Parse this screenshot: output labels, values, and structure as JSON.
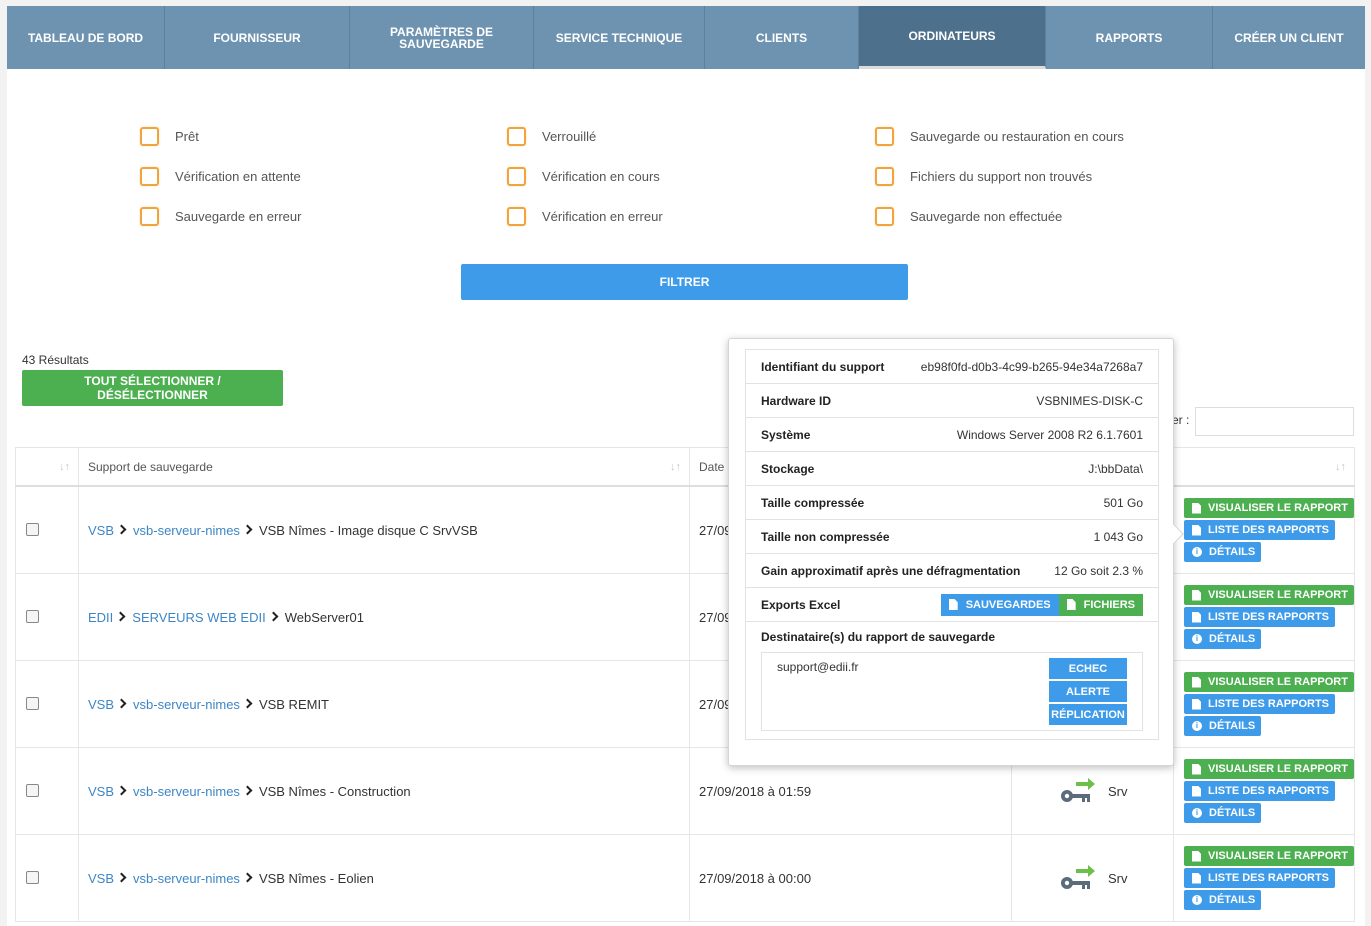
{
  "nav": {
    "tabs": [
      {
        "label": "TABLEAU DE BORD",
        "active": false
      },
      {
        "label": "FOURNISSEUR",
        "active": false
      },
      {
        "label": "PARAMÈTRES DE SAUVEGARDE",
        "active": false
      },
      {
        "label": "SERVICE TECHNIQUE",
        "active": false
      },
      {
        "label": "CLIENTS",
        "active": false
      },
      {
        "label": "ORDINATEURS",
        "active": true
      },
      {
        "label": "RAPPORTS",
        "active": false
      },
      {
        "label": "CRÉER UN CLIENT",
        "active": false
      }
    ]
  },
  "filters": {
    "items": [
      {
        "label": "Prêt",
        "checked": false
      },
      {
        "label": "Verrouillé",
        "checked": false
      },
      {
        "label": "Sauvegarde ou restauration en cours",
        "checked": false
      },
      {
        "label": "Vérification en attente",
        "checked": false
      },
      {
        "label": "Vérification en cours",
        "checked": false
      },
      {
        "label": "Fichiers du support non trouvés",
        "checked": false
      },
      {
        "label": "Sauvegarde en erreur",
        "checked": false
      },
      {
        "label": "Vérification en erreur",
        "checked": false
      },
      {
        "label": "Sauvegarde non effectuée",
        "checked": false
      }
    ],
    "button_label": "FILTRER"
  },
  "results": {
    "count_text": "43 Résultats",
    "select_all_label": "TOUT SÉLECTIONNER / DÉSÉLECTIONNER",
    "search_label": "er :"
  },
  "table": {
    "headers": {
      "support": "Support de sauvegarde",
      "date": "Date"
    },
    "rows": [
      {
        "path": [
          "VSB",
          "vsb-serveur-nimes"
        ],
        "name": "VSB Nîmes - Image disque C SrvVSB",
        "date": "27/09",
        "device": ""
      },
      {
        "path": [
          "EDII",
          "SERVEURS WEB EDII"
        ],
        "name": "WebServer01",
        "date": "27/09",
        "device": ""
      },
      {
        "path": [
          "VSB",
          "vsb-serveur-nimes"
        ],
        "name": "VSB REMIT",
        "date": "27/09",
        "device": ""
      },
      {
        "path": [
          "VSB",
          "vsb-serveur-nimes"
        ],
        "name": "VSB Nîmes - Construction",
        "date": "27/09/2018 à 01:59",
        "device": "Srv"
      },
      {
        "path": [
          "VSB",
          "vsb-serveur-nimes"
        ],
        "name": "VSB Nîmes - Eolien",
        "date": "27/09/2018 à 00:00",
        "device": "Srv"
      }
    ],
    "actions": {
      "view_report": "VISUALISER LE RAPPORT",
      "report_list": "LISTE DES RAPPORTS",
      "details": "DÉTAILS"
    }
  },
  "popover": {
    "rows": [
      {
        "label": "Identifiant du support",
        "value": "eb98f0fd-d0b3-4c99-b265-94e34a7268a7"
      },
      {
        "label": "Hardware ID",
        "value": "VSBNIMES-DISK-C"
      },
      {
        "label": "Système",
        "value": "Windows Server 2008 R2 6.1.7601"
      },
      {
        "label": "Stockage",
        "value": "J:\\bbData\\"
      },
      {
        "label": "Taille compressée",
        "value": "501 Go"
      },
      {
        "label": "Taille non compressée",
        "value": "1 043 Go"
      },
      {
        "label": "Gain approximatif après une défragmentation",
        "value": "12 Go soit 2.3 %"
      }
    ],
    "exports_label": "Exports Excel",
    "export_buttons": {
      "backups": "SAUVEGARDES",
      "files": "FICHIERS"
    },
    "recipients_label": "Destinataire(s) du rapport de sauvegarde",
    "recipient_email": "support@edii.fr",
    "recipient_buttons": [
      "ECHEC",
      "ALERTE",
      "RÉPLICATION"
    ]
  },
  "colors": {
    "nav": "#6d93b0",
    "nav_active": "#4d708d",
    "primary": "#3d9be9",
    "success": "#4caf50",
    "checkbox": "#f0a43c",
    "link": "#3d86c6"
  }
}
